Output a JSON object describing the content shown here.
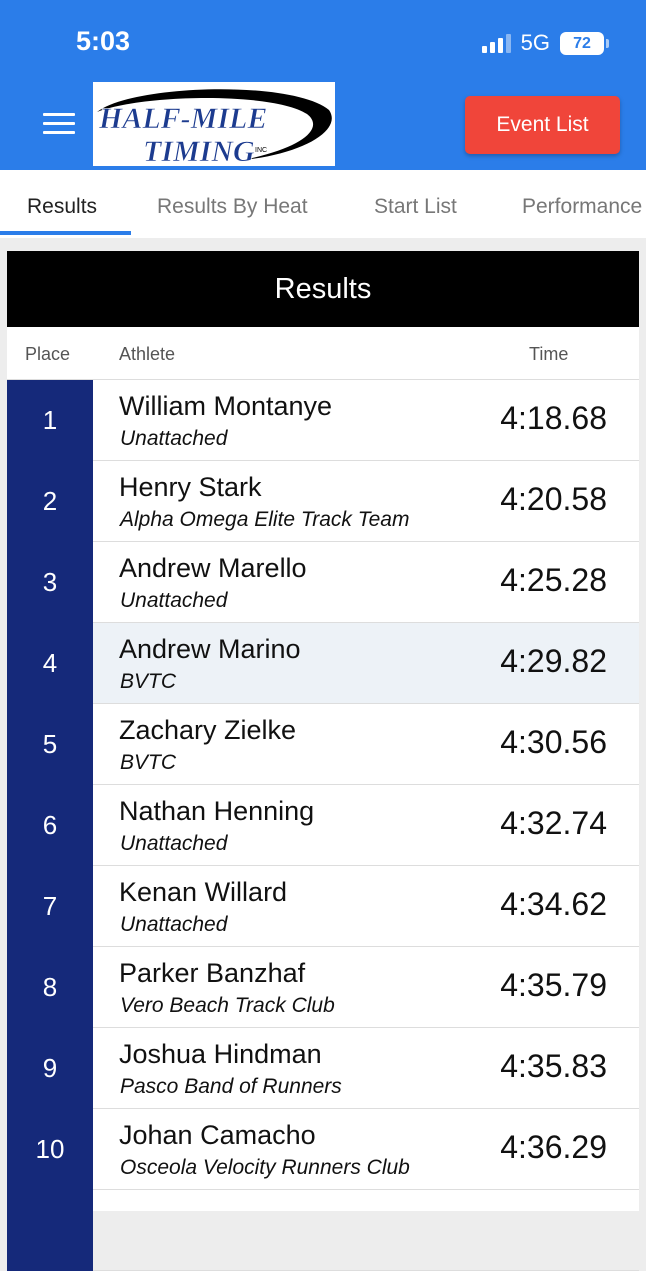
{
  "status_bar": {
    "time": "5:03",
    "network": "5G",
    "battery": "72"
  },
  "header": {
    "logo_line1": "HALF-MILE",
    "logo_line2": "TIMING",
    "logo_inc": "INC",
    "event_list_label": "Event List"
  },
  "tabs": [
    {
      "label": "Results",
      "active": true
    },
    {
      "label": "Results By Heat",
      "active": false
    },
    {
      "label": "Start List",
      "active": false
    },
    {
      "label": "Performance",
      "active": false
    }
  ],
  "results": {
    "title": "Results",
    "columns": {
      "place": "Place",
      "athlete": "Athlete",
      "time": "Time"
    },
    "rows": [
      {
        "place": "1",
        "name": "William Montanye",
        "team": "Unattached",
        "time": "4:18.68"
      },
      {
        "place": "2",
        "name": "Henry Stark",
        "team": "Alpha Omega Elite Track Team",
        "time": "4:20.58"
      },
      {
        "place": "3",
        "name": "Andrew Marello",
        "team": "Unattached",
        "time": "4:25.28"
      },
      {
        "place": "4",
        "name": "Andrew Marino",
        "team": "BVTC",
        "time": "4:29.82"
      },
      {
        "place": "5",
        "name": "Zachary Zielke",
        "team": "BVTC",
        "time": "4:30.56"
      },
      {
        "place": "6",
        "name": "Nathan Henning",
        "team": "Unattached",
        "time": "4:32.74"
      },
      {
        "place": "7",
        "name": "Kenan Willard",
        "team": "Unattached",
        "time": "4:34.62"
      },
      {
        "place": "8",
        "name": "Parker Banzhaf",
        "team": "Vero Beach Track Club",
        "time": "4:35.79"
      },
      {
        "place": "9",
        "name": "Joshua Hindman",
        "team": "Pasco Band of Runners",
        "time": "4:35.83"
      },
      {
        "place": "10",
        "name": "Johan Camacho",
        "team": "Osceola Velocity Runners Club",
        "time": "4:36.29"
      }
    ]
  },
  "colors": {
    "header_blue": "#2b7de9",
    "place_navy": "#15297a",
    "event_button_red": "#f0453a",
    "row_highlight": "#edf2f7"
  }
}
